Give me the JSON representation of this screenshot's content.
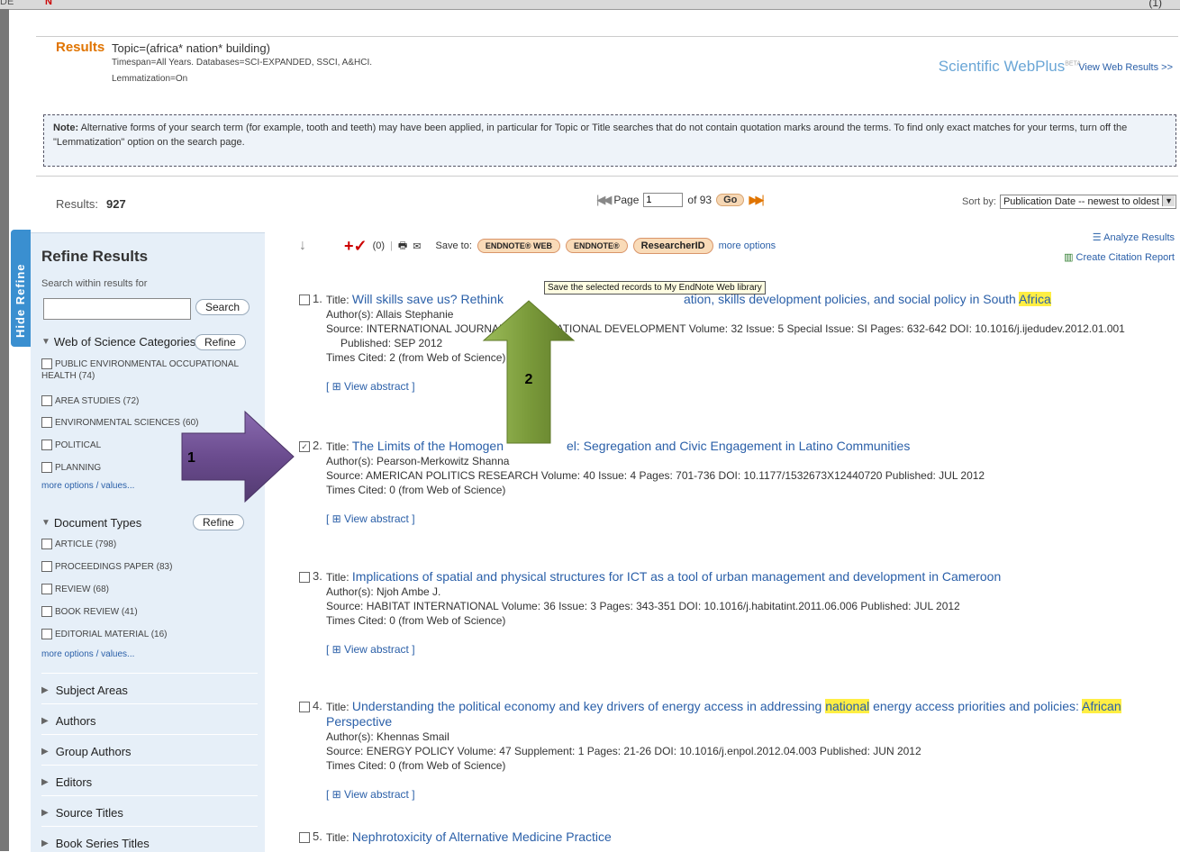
{
  "chrome": {
    "left_text": "DE",
    "tab_mark": "N",
    "right_text": "(1)"
  },
  "results_header": {
    "label": "Results",
    "topic": "Topic=(africa* nation* building)",
    "timespan": "Timespan=All Years. Databases=SCI-EXPANDED, SSCI, A&HCI.",
    "lemmatization": "Lemmatization=On",
    "scientific_webplus": "Scientific WebPlus",
    "beta": "BETA",
    "view_web_results": "View Web Results >>"
  },
  "note": {
    "label": "Note:",
    "text": "Alternative forms of your search term (for example, tooth and teeth) may have been applied, in particular for Topic or Title searches that do not contain quotation marks around the terms. To find only exact matches for your terms, turn off the \"Lemmatization\" option on the search page."
  },
  "results_bar": {
    "count_label": "Results:",
    "count": "927",
    "page_label": "Page",
    "page_value": "1",
    "of_pages": "of 93",
    "go": "Go",
    "sort_label": "Sort by:",
    "sort_value": "Publication Date -- newest to oldest"
  },
  "sidebar": {
    "hide_refine": "Hide Refine",
    "title": "Refine Results",
    "search_within": "Search within results for",
    "search_button": "Search",
    "wos_categories": {
      "label": "Web of Science Categories",
      "refine": "Refine",
      "items": [
        "PUBLIC ENVIRONMENTAL OCCUPATIONAL HEALTH (74)",
        "AREA STUDIES (72)",
        "ENVIRONMENTAL SCIENCES (60)",
        "POLITICAL",
        "PLANNING"
      ],
      "more": "more options / values..."
    },
    "document_types": {
      "label": "Document Types",
      "refine": "Refine",
      "items": [
        "ARTICLE (798)",
        "PROCEEDINGS PAPER (83)",
        "REVIEW (68)",
        "BOOK REVIEW (41)",
        "EDITORIAL MATERIAL (16)"
      ],
      "more": "more options / values..."
    },
    "collapsed": [
      "Subject Areas",
      "Authors",
      "Group Authors",
      "Editors",
      "Source Titles",
      "Book Series Titles"
    ]
  },
  "toolbar": {
    "marked_count": "(0)",
    "save_to": "Save to:",
    "endnote_web": "ENDNOTE® WEB",
    "endnote": "ENDNOTE®",
    "researcherid": "ResearcherID",
    "more_options": "more options",
    "analyze": "Analyze Results",
    "citation_report": "Create Citation Report",
    "tooltip": "Save the selected records to My EndNote Web library"
  },
  "records": [
    {
      "num": "1.",
      "title_a": "Will skills save us? Rethink",
      "title_b": "ation, skills development policies, and social policy in South ",
      "title_hl": "Africa",
      "authors": "Author(s): Allais Stephanie",
      "source": "Source: INTERNATIONAL JOURNAL OF EDUCATIONAL DEVELOPMENT  Volume: 32  Issue: 5  Special Issue: SI  Pages: 632-642  DOI: 10.1016/j.ijedudev.2012.01.001",
      "published": "Published: SEP 2012",
      "cited": "Times Cited: 2 (from Web of Science)",
      "abstract": "[ ⊞ View abstract ]",
      "checked": false
    },
    {
      "num": "2.",
      "title_a": "The Limits of the Homogen",
      "title_b": "el: Segregation and Civic Engagement in Latino Communities",
      "authors": "Author(s): Pearson-Merkowitz Shanna",
      "source": "Source: AMERICAN POLITICS RESEARCH  Volume: 40  Issue: 4  Pages: 701-736  DOI: 10.1177/1532673X12440720  Published: JUL 2012",
      "cited": "Times Cited: 0 (from Web of Science)",
      "abstract": "[ ⊞ View abstract ]",
      "checked": true
    },
    {
      "num": "3.",
      "title": "Implications of spatial and physical structures for ICT as a tool of urban management and development in Cameroon",
      "authors": "Author(s): Njoh Ambe J.",
      "source": "Source: HABITAT INTERNATIONAL  Volume: 36  Issue: 3  Pages: 343-351  DOI: 10.1016/j.habitatint.2011.06.006  Published: JUL 2012",
      "cited": "Times Cited: 0 (from Web of Science)",
      "abstract": "[ ⊞ View abstract ]",
      "checked": false
    },
    {
      "num": "4.",
      "title_a": "Understanding the political economy and key drivers of energy access in addressing ",
      "title_hl1": "national",
      "title_b": " energy access priorities and policies: ",
      "title_hl2": "African",
      "title_c": " Perspective",
      "authors": "Author(s): Khennas Smail",
      "source": "Source: ENERGY POLICY  Volume: 47  Supplement: 1  Pages: 21-26  DOI: 10.1016/j.enpol.2012.04.003  Published: JUN 2012",
      "cited": "Times Cited: 0 (from Web of Science)",
      "abstract": "[ ⊞ View abstract ]",
      "checked": false
    },
    {
      "num": "5.",
      "title": "Nephrotoxicity of Alternative Medicine Practice",
      "checked": false
    }
  ],
  "annotations": {
    "arrow1_label": "1",
    "arrow2_label": "2",
    "arrow1_color": "#6b4c8f",
    "arrow2_color": "#7a9a3a"
  }
}
